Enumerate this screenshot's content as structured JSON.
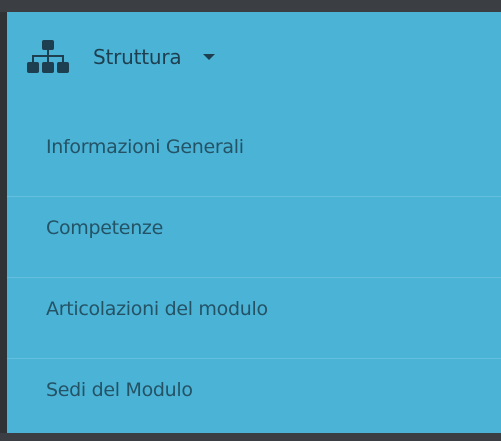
{
  "menu": {
    "header": {
      "label": "Struttura",
      "icon": "sitemap-icon"
    },
    "items": [
      {
        "label": "Informazioni Generali"
      },
      {
        "label": "Competenze"
      },
      {
        "label": "Articolazioni del modulo"
      },
      {
        "label": "Sedi del Modulo"
      }
    ]
  },
  "colors": {
    "menu_background": "#4ab3d6",
    "dark_frame": "#3b3e42",
    "header_text": "#1e3f4f",
    "item_text": "#255366",
    "divider": "#63bfdd"
  }
}
